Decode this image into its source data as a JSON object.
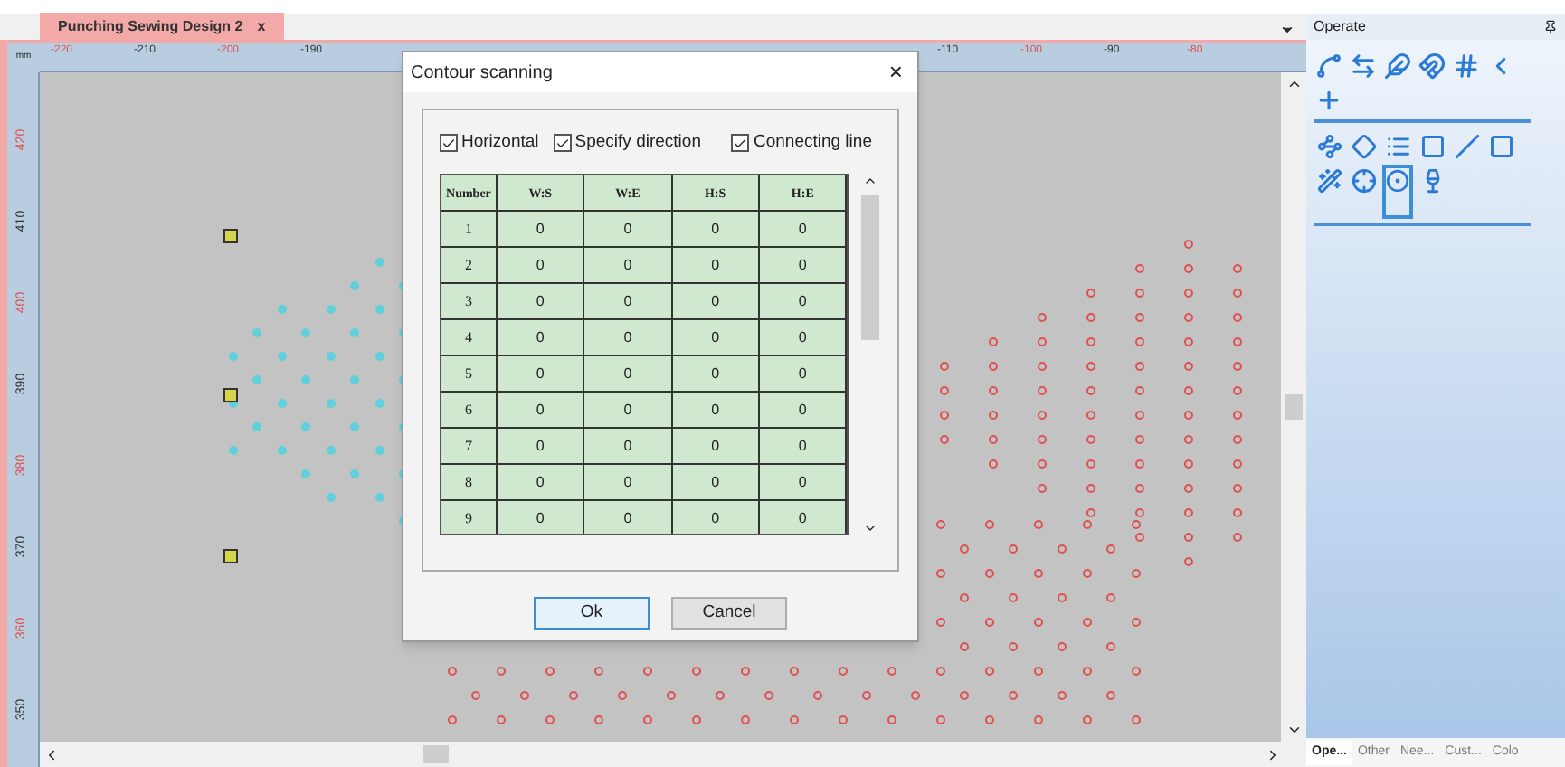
{
  "document_tab": {
    "title": "Punching Sewing Design 2",
    "close": "x",
    "selected": true
  },
  "ruler": {
    "unit": "mm",
    "top_ticks": [
      {
        "label": "-220",
        "color": "#e05050"
      },
      {
        "label": "-210",
        "color": "#333333"
      },
      {
        "label": "-200",
        "color": "#e05050"
      },
      {
        "label": "-190",
        "color": "#333333"
      },
      {
        "label": "-110",
        "color": "#333333"
      },
      {
        "label": "-100",
        "color": "#e05050"
      },
      {
        "label": "-90",
        "color": "#333333"
      },
      {
        "label": "-80",
        "color": "#e05050"
      }
    ],
    "left_ticks": [
      {
        "label": "420",
        "color": "#e05050"
      },
      {
        "label": "410",
        "color": "#333333"
      },
      {
        "label": "400",
        "color": "#e05050"
      },
      {
        "label": "390",
        "color": "#333333"
      },
      {
        "label": "380",
        "color": "#e05050"
      },
      {
        "label": "370",
        "color": "#333333"
      },
      {
        "label": "360",
        "color": "#e05050"
      },
      {
        "label": "350",
        "color": "#333333"
      }
    ]
  },
  "dialog": {
    "title": "Contour scanning",
    "close": "×",
    "options": [
      {
        "label": "Horizontal",
        "checked": true
      },
      {
        "label": "Specify direction",
        "checked": true
      },
      {
        "label": "Connecting line",
        "checked": true
      }
    ],
    "table": {
      "columns": [
        "Number",
        "W:S",
        "W:E",
        "H:S",
        "H:E"
      ],
      "rows": [
        [
          "1",
          "0",
          "0",
          "0",
          "0"
        ],
        [
          "2",
          "0",
          "0",
          "0",
          "0"
        ],
        [
          "3",
          "0",
          "0",
          "0",
          "0"
        ],
        [
          "4",
          "0",
          "0",
          "0",
          "0"
        ],
        [
          "5",
          "0",
          "0",
          "0",
          "0"
        ],
        [
          "6",
          "0",
          "0",
          "0",
          "0"
        ],
        [
          "7",
          "0",
          "0",
          "0",
          "0"
        ],
        [
          "8",
          "0",
          "0",
          "0",
          "0"
        ],
        [
          "9",
          "0",
          "0",
          "0",
          "0"
        ]
      ]
    },
    "buttons": [
      {
        "label": "Ok",
        "selected": true
      },
      {
        "label": "Cancel",
        "selected": false
      }
    ]
  },
  "panel": {
    "title": "Operate",
    "tools": [
      {
        "selected": false
      },
      {
        "selected": false
      },
      {
        "selected": false
      },
      {
        "selected": false
      },
      {
        "selected": false
      },
      {
        "selected": false
      },
      {
        "selected": false
      },
      {
        "selected": false
      },
      {
        "selected": false
      },
      {
        "selected": false
      },
      {
        "selected": false
      },
      {
        "selected": false
      },
      {
        "selected": false
      },
      {
        "selected": false
      },
      {
        "selected": false
      },
      {
        "selected": true
      },
      {
        "selected": false
      }
    ],
    "tabs": [
      {
        "label": "Ope...",
        "selected": true
      },
      {
        "label": "Other",
        "selected": false
      },
      {
        "label": "Nee...",
        "selected": false
      },
      {
        "label": "Cust...",
        "selected": false
      },
      {
        "label": "Colo",
        "selected": false
      }
    ]
  }
}
